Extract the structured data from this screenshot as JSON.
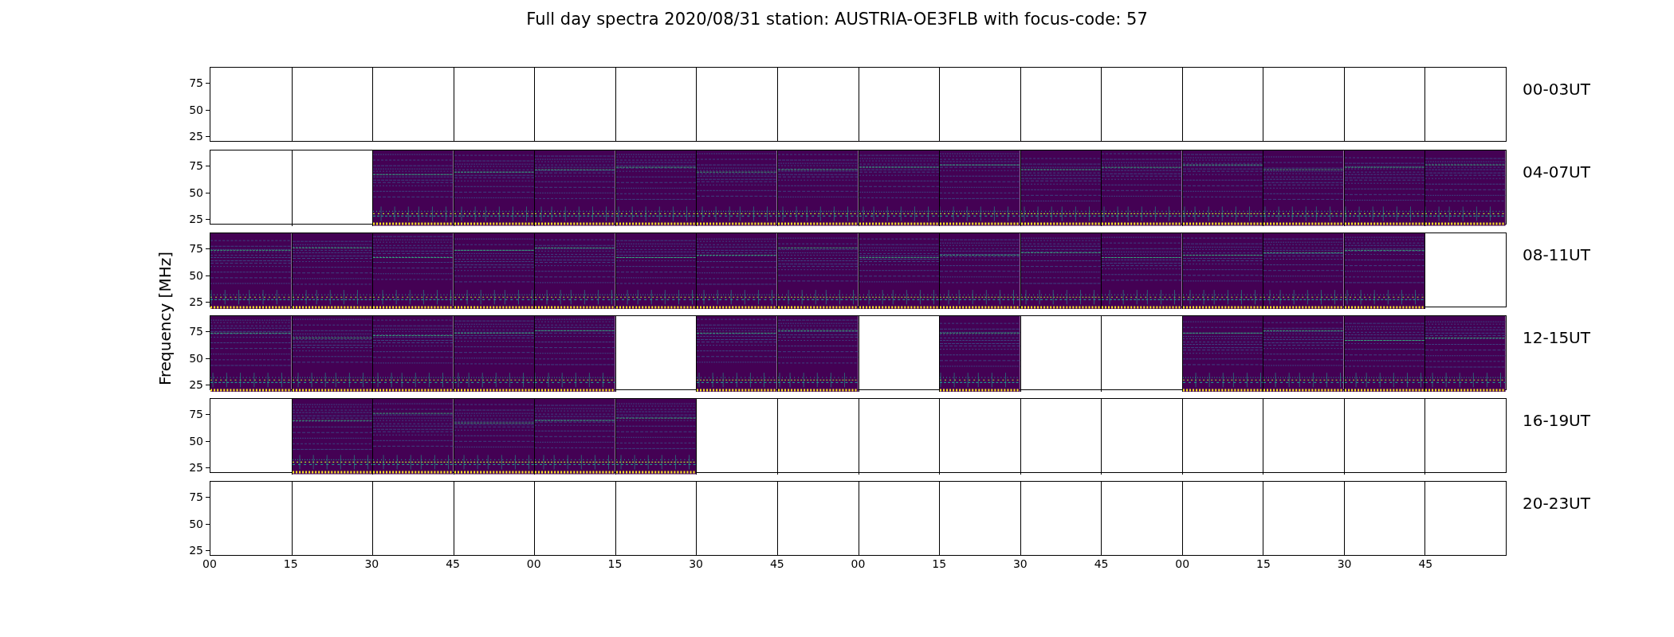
{
  "title": "Full day spectra 2020/08/31 station: AUSTRIA-OE3FLB with focus-code: 57",
  "ylabel": "Frequency [MHz]",
  "rows": [
    {
      "label": "00-03UT",
      "yticks": [
        "75",
        "50",
        "25"
      ],
      "cells": [
        {
          "kind": "empty"
        },
        {
          "kind": "empty"
        },
        {
          "kind": "empty"
        },
        {
          "kind": "empty"
        },
        {
          "kind": "empty"
        },
        {
          "kind": "empty"
        },
        {
          "kind": "empty"
        },
        {
          "kind": "empty"
        },
        {
          "kind": "empty"
        },
        {
          "kind": "empty"
        },
        {
          "kind": "empty"
        },
        {
          "kind": "empty"
        },
        {
          "kind": "empty"
        },
        {
          "kind": "empty"
        },
        {
          "kind": "empty"
        },
        {
          "kind": "empty"
        }
      ]
    },
    {
      "label": "04-07UT",
      "yticks": [
        "75",
        "50",
        "25"
      ],
      "cells": [
        {
          "kind": "empty"
        },
        {
          "kind": "empty"
        },
        {
          "kind": "spectrum"
        },
        {
          "kind": "spectrum"
        },
        {
          "kind": "spectrum"
        },
        {
          "kind": "spectrum"
        },
        {
          "kind": "spectrum"
        },
        {
          "kind": "spectrum"
        },
        {
          "kind": "spectrum"
        },
        {
          "kind": "spectrum"
        },
        {
          "kind": "spectrum"
        },
        {
          "kind": "spectrum"
        },
        {
          "kind": "spectrum"
        },
        {
          "kind": "spectrum"
        },
        {
          "kind": "spectrum"
        },
        {
          "kind": "spectrum"
        }
      ]
    },
    {
      "label": "08-11UT",
      "yticks": [
        "75",
        "50",
        "25"
      ],
      "cells": [
        {
          "kind": "spectrum"
        },
        {
          "kind": "spectrum"
        },
        {
          "kind": "spectrum"
        },
        {
          "kind": "spectrum"
        },
        {
          "kind": "spectrum"
        },
        {
          "kind": "spectrum"
        },
        {
          "kind": "spectrum"
        },
        {
          "kind": "spectrum"
        },
        {
          "kind": "spectrum"
        },
        {
          "kind": "spectrum"
        },
        {
          "kind": "spectrum"
        },
        {
          "kind": "spectrum"
        },
        {
          "kind": "spectrum"
        },
        {
          "kind": "spectrum"
        },
        {
          "kind": "spectrum"
        },
        {
          "kind": "empty"
        }
      ]
    },
    {
      "label": "12-15UT",
      "yticks": [
        "75",
        "50",
        "25"
      ],
      "cells": [
        {
          "kind": "spectrum"
        },
        {
          "kind": "spectrum"
        },
        {
          "kind": "spectrum"
        },
        {
          "kind": "spectrum"
        },
        {
          "kind": "spectrum"
        },
        {
          "kind": "empty"
        },
        {
          "kind": "spectrum"
        },
        {
          "kind": "spectrum"
        },
        {
          "kind": "empty"
        },
        {
          "kind": "spectrum"
        },
        {
          "kind": "empty"
        },
        {
          "kind": "empty"
        },
        {
          "kind": "spectrum"
        },
        {
          "kind": "spectrum"
        },
        {
          "kind": "spectrum"
        },
        {
          "kind": "spectrum"
        }
      ]
    },
    {
      "label": "16-19UT",
      "yticks": [
        "75",
        "50",
        "25"
      ],
      "cells": [
        {
          "kind": "empty"
        },
        {
          "kind": "spectrum"
        },
        {
          "kind": "spectrum"
        },
        {
          "kind": "spectrum"
        },
        {
          "kind": "spectrum"
        },
        {
          "kind": "spectrum"
        },
        {
          "kind": "empty"
        },
        {
          "kind": "empty"
        },
        {
          "kind": "empty"
        },
        {
          "kind": "empty"
        },
        {
          "kind": "empty"
        },
        {
          "kind": "empty"
        },
        {
          "kind": "empty"
        },
        {
          "kind": "empty"
        },
        {
          "kind": "empty"
        },
        {
          "kind": "empty"
        }
      ]
    },
    {
      "label": "20-23UT",
      "yticks": [
        "75",
        "50",
        "25"
      ],
      "cells": [
        {
          "kind": "empty"
        },
        {
          "kind": "empty"
        },
        {
          "kind": "empty"
        },
        {
          "kind": "empty"
        },
        {
          "kind": "empty"
        },
        {
          "kind": "empty"
        },
        {
          "kind": "empty"
        },
        {
          "kind": "empty"
        },
        {
          "kind": "empty"
        },
        {
          "kind": "empty"
        },
        {
          "kind": "empty"
        },
        {
          "kind": "empty"
        },
        {
          "kind": "empty"
        },
        {
          "kind": "empty"
        },
        {
          "kind": "empty"
        },
        {
          "kind": "empty"
        }
      ]
    }
  ],
  "xticks": [
    "00",
    "15",
    "30",
    "45",
    "00",
    "15",
    "30",
    "45",
    "00",
    "15",
    "30",
    "45",
    "00",
    "15",
    "30",
    "45"
  ]
}
